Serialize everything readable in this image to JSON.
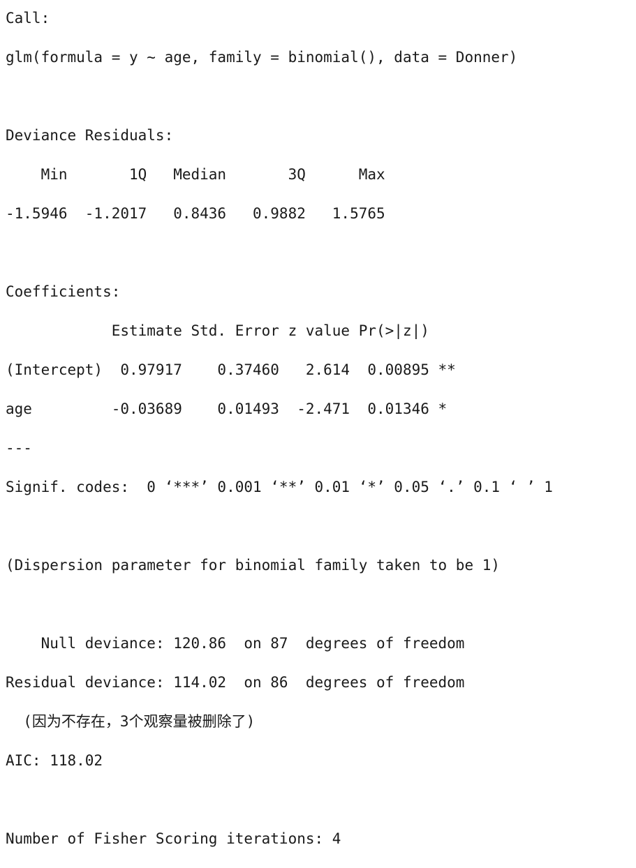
{
  "console": {
    "lines": [
      "Call:",
      "glm(formula = y ~ age, family = binomial(), data = Donner)",
      "",
      "Deviance Residuals:",
      "    Min       1Q   Median       3Q      Max  ",
      "-1.5946  -1.2017   0.8436   0.9882   1.5765  ",
      "",
      "Coefficients:",
      "            Estimate Std. Error z value Pr(>|z|)   ",
      "(Intercept)  0.97917    0.37460   2.614  0.00895 **",
      "age         -0.03689    0.01493  -2.471  0.01346 * ",
      "---",
      "Signif. codes:  0 ‘***’ 0.001 ‘**’ 0.01 ‘*’ 0.05 ‘.’ 0.1 ‘ ’ 1",
      "",
      "(Dispersion parameter for binomial family taken to be 1)",
      "",
      "    Null deviance: 120.86  on 87  degrees of freedom",
      "Residual deviance: 114.02  on 86  degrees of freedom",
      "  (因为不存在，3个观察量被删除了)",
      "AIC: 118.02",
      "",
      "Number of Fisher Scoring iterations: 4"
    ]
  }
}
